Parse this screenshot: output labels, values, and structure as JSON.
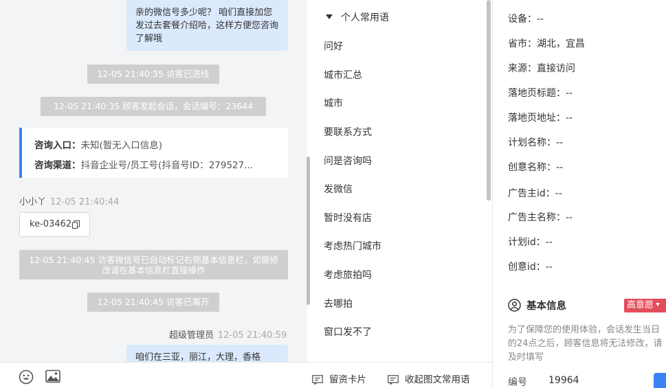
{
  "chat": {
    "top_bubble": "亲的微信号多少呢？ 咱们直接加您发过去套餐介绍哈，这样方便您咨询了解哦",
    "sys_visitor_entered": "12-05 21:40:35 访客已进线",
    "sys_session_started": "12-05 21:40:35 顾客发起会话，会话编号：23644",
    "entry_label": "咨询入口：",
    "entry_value": "未知(暂无入口信息)",
    "channel_label": "咨询渠道：",
    "channel_value": "抖音企业号/员工号(抖音号ID：279527...",
    "customer_name": "小小丫",
    "customer_time": "12-05 21:40:44",
    "customer_msg": "ke-03462",
    "sys_wechat_marked": "12-05 21:40:45 访客微信号已自动标记右侧基本信息栏，如需修改请在基本信息栏直接操作",
    "sys_visitor_left": "12-05 21:40:45 访客已离开",
    "agent_name": "超级管理员",
    "agent_time": "12-05 21:40:59",
    "agent_msg": "咱们在三亚，丽江，大理，香格"
  },
  "toolbar": {
    "emoji_icon": "smile-icon",
    "image_icon": "image-icon",
    "card_label": "留资卡片",
    "collapse_label": "收起图文常用语"
  },
  "phrases": {
    "header": "个人常用语",
    "items": [
      "问好",
      "城市汇总",
      "城市",
      "要联系方式",
      "问是咨询吗",
      "发微信",
      "暂时没有店",
      "考虑热门城市",
      "考虑旅拍吗",
      "去哪拍",
      "窗口发不了"
    ]
  },
  "info": {
    "rows": [
      "设备：--",
      "省市：湖北，宜昌",
      "来源：直接访问",
      "落地页标题：--",
      "落地页地址：--",
      "计划名称：--",
      "创意名称：--",
      "广告主id：--",
      "广告主名称：--",
      "计划id：--",
      "创意id：--"
    ],
    "basic_title": "基本信息",
    "intent_badge": "高意愿",
    "notice": "为了保障您的使用体验，会话发生当日的24点之后，顾客信息将无法修改，请及时填写",
    "number_label": "编号",
    "number_value": "19964"
  },
  "colors": {
    "accent": "#3b82f6",
    "bubble": "#dbe9fd",
    "system": "#cfcfcf",
    "intent": "#e34d59"
  }
}
